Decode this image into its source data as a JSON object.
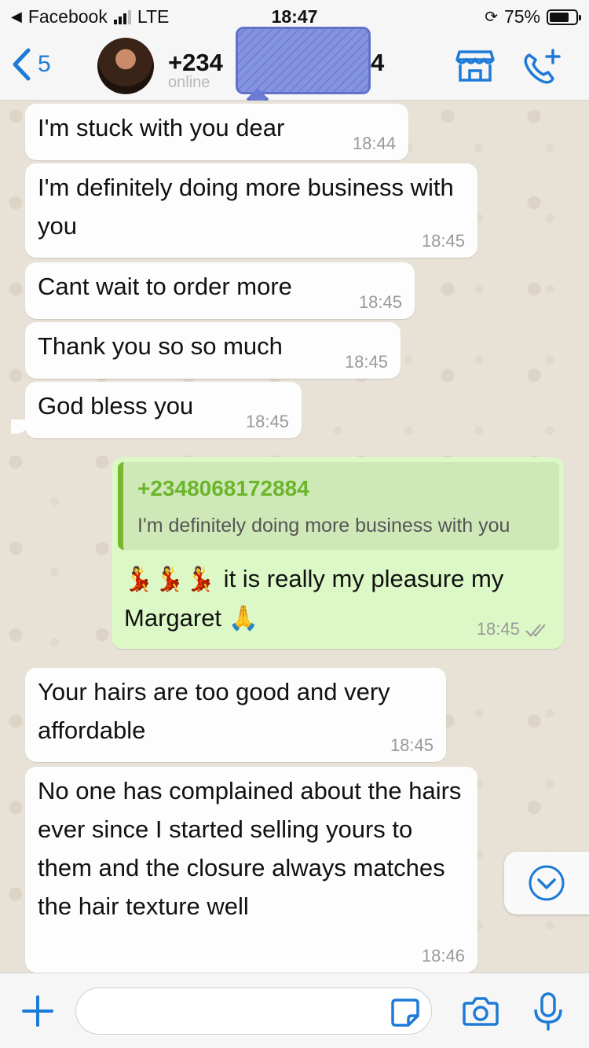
{
  "status_bar": {
    "back_app": "Facebook",
    "network": "LTE",
    "time": "18:47",
    "battery": "75%",
    "battery_level": 0.75
  },
  "header": {
    "back_count": "5",
    "contact_name_visible_start": "+234",
    "contact_name_visible_end": "4",
    "status": "online"
  },
  "messages": [
    {
      "text": "I'm stuck with you dear",
      "time": "18:44"
    },
    {
      "text": "I'm definitely doing more business with you",
      "time": "18:45"
    },
    {
      "text": "Cant wait to order more",
      "time": "18:45"
    },
    {
      "text": "Thank you so so much",
      "time": "18:45"
    },
    {
      "text": "God bless you",
      "time": "18:45"
    },
    {
      "quote_name": "+2348068172884",
      "quote_text": "I'm definitely doing more business with you",
      "emoji_prefix": "💃💃💃",
      "text": " it is really my pleasure my Margaret 🙏",
      "time": "18:45"
    },
    {
      "text": "Your hairs are too good and very affordable",
      "time": "18:45"
    },
    {
      "text": "No one has complained about the hairs ever since I started selling yours to them and the closure always matches the hair texture well",
      "time": "18:46"
    }
  ],
  "input": {
    "placeholder": "",
    "value": ""
  },
  "colors": {
    "accent": "#1d7bd7",
    "outgoing_bubble": "#dcf8c6",
    "incoming_bubble": "#fdfdfd",
    "quote_name": "#6bb52b"
  },
  "icons": {
    "back": "chevron-left-icon",
    "shop": "storefront-icon",
    "call": "add-call-icon",
    "scroll": "chevron-down-circle-icon",
    "plus": "plus-icon",
    "sticker": "sticker-icon",
    "camera": "camera-icon",
    "mic": "microphone-icon"
  }
}
